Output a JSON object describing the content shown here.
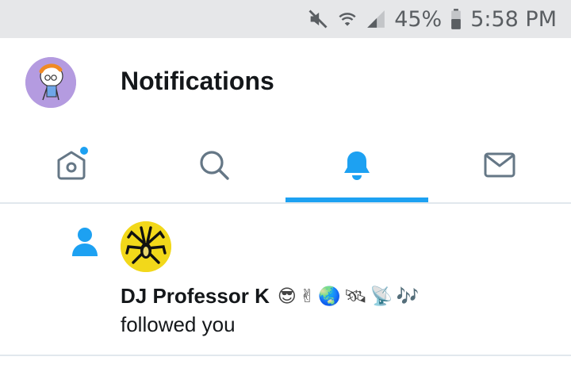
{
  "status_bar": {
    "battery": "45%",
    "time": "5:58 PM",
    "icons": [
      "mute-icon",
      "wifi-icon",
      "signal-icon",
      "battery-icon"
    ]
  },
  "header": {
    "title": "Notifications",
    "avatar_icon": "profile-avatar"
  },
  "tabs": [
    {
      "name": "home",
      "icon": "home-icon",
      "badge": true,
      "active": false
    },
    {
      "name": "search",
      "icon": "search-icon",
      "active": false
    },
    {
      "name": "notifications",
      "icon": "bell-icon",
      "active": true
    },
    {
      "name": "messages",
      "icon": "mail-icon",
      "active": false
    }
  ],
  "notification": {
    "icon": "person-follow-icon",
    "avatar_icon": "spider-avatar",
    "name": "DJ Professor K",
    "emojis": "😎✌🌏🛰📡🎶",
    "action": "followed you"
  },
  "colors": {
    "accent": "#1da1f2",
    "status_bar_bg": "#e6e7e9",
    "inactive_icon": "#657786",
    "text": "#14171a"
  }
}
